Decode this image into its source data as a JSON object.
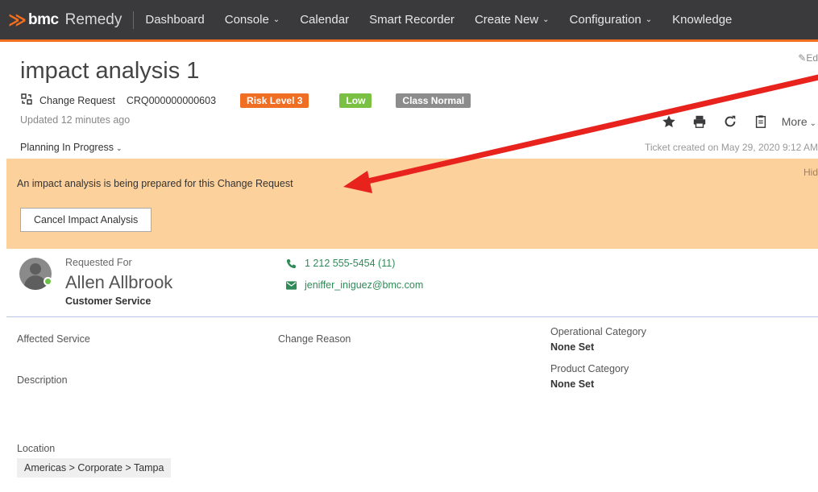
{
  "nav": {
    "brand": "bmc",
    "product": "Remedy",
    "items": [
      {
        "label": "Dashboard",
        "dropdown": false
      },
      {
        "label": "Console",
        "dropdown": true
      },
      {
        "label": "Calendar",
        "dropdown": false
      },
      {
        "label": "Smart Recorder",
        "dropdown": false
      },
      {
        "label": "Create New",
        "dropdown": true
      },
      {
        "label": "Configuration",
        "dropdown": true
      },
      {
        "label": "Knowledge",
        "dropdown": false
      }
    ]
  },
  "ticket": {
    "title": "impact analysis 1",
    "edit_label": "Ed",
    "type": "Change Request",
    "id": "CRQ000000000603",
    "risk_badge": "Risk Level 3",
    "priority_badge": "Low",
    "class_badge": "Class Normal",
    "updated": "Updated 12 minutes ago",
    "status": "Planning In Progress",
    "created": "Ticket created on May 29, 2020 9:12 AM",
    "more_label": "More"
  },
  "banner": {
    "message": "An impact analysis is being prepared for this Change Request",
    "hide_label": "Hid",
    "cancel_button": "Cancel Impact Analysis"
  },
  "customer": {
    "label": "Requested For",
    "name": "Allen Allbrook",
    "department": "Customer Service",
    "phone": "1 212 555-5454 (11)",
    "email": "jeniffer_iniguez@bmc.com"
  },
  "details": {
    "affected_service_label": "Affected Service",
    "change_reason_label": "Change Reason",
    "operational_category_label": "Operational Category",
    "operational_category_value": "None Set",
    "product_category_label": "Product Category",
    "product_category_value": "None Set",
    "description_label": "Description",
    "location_label": "Location",
    "location_value": "Americas > Corporate > Tampa"
  },
  "colors": {
    "nav_bg": "#3a3a3c",
    "accent": "#f37021",
    "banner_bg": "#fdd19c",
    "risk": "#f06d24",
    "low": "#7ac143",
    "class": "#8c8c8c",
    "link": "#2e8b57",
    "annotation_arrow": "#e8231d"
  },
  "icons": {
    "toolbar": [
      "star-icon",
      "print-icon",
      "refresh-icon",
      "copy-icon"
    ]
  }
}
